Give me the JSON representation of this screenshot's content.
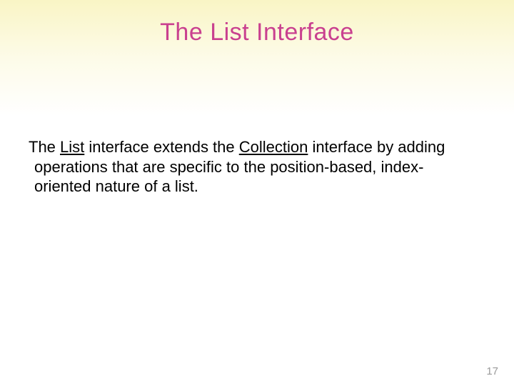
{
  "title": "The List Interface",
  "body": {
    "seg1_pre": "The ",
    "seg2_link1": "List",
    "seg3_mid": " interface extends the ",
    "seg4_link2": "Collection",
    "seg5_post": " interface by adding operations that are specific to the position-based, index-oriented nature of a list."
  },
  "page_number": "17"
}
